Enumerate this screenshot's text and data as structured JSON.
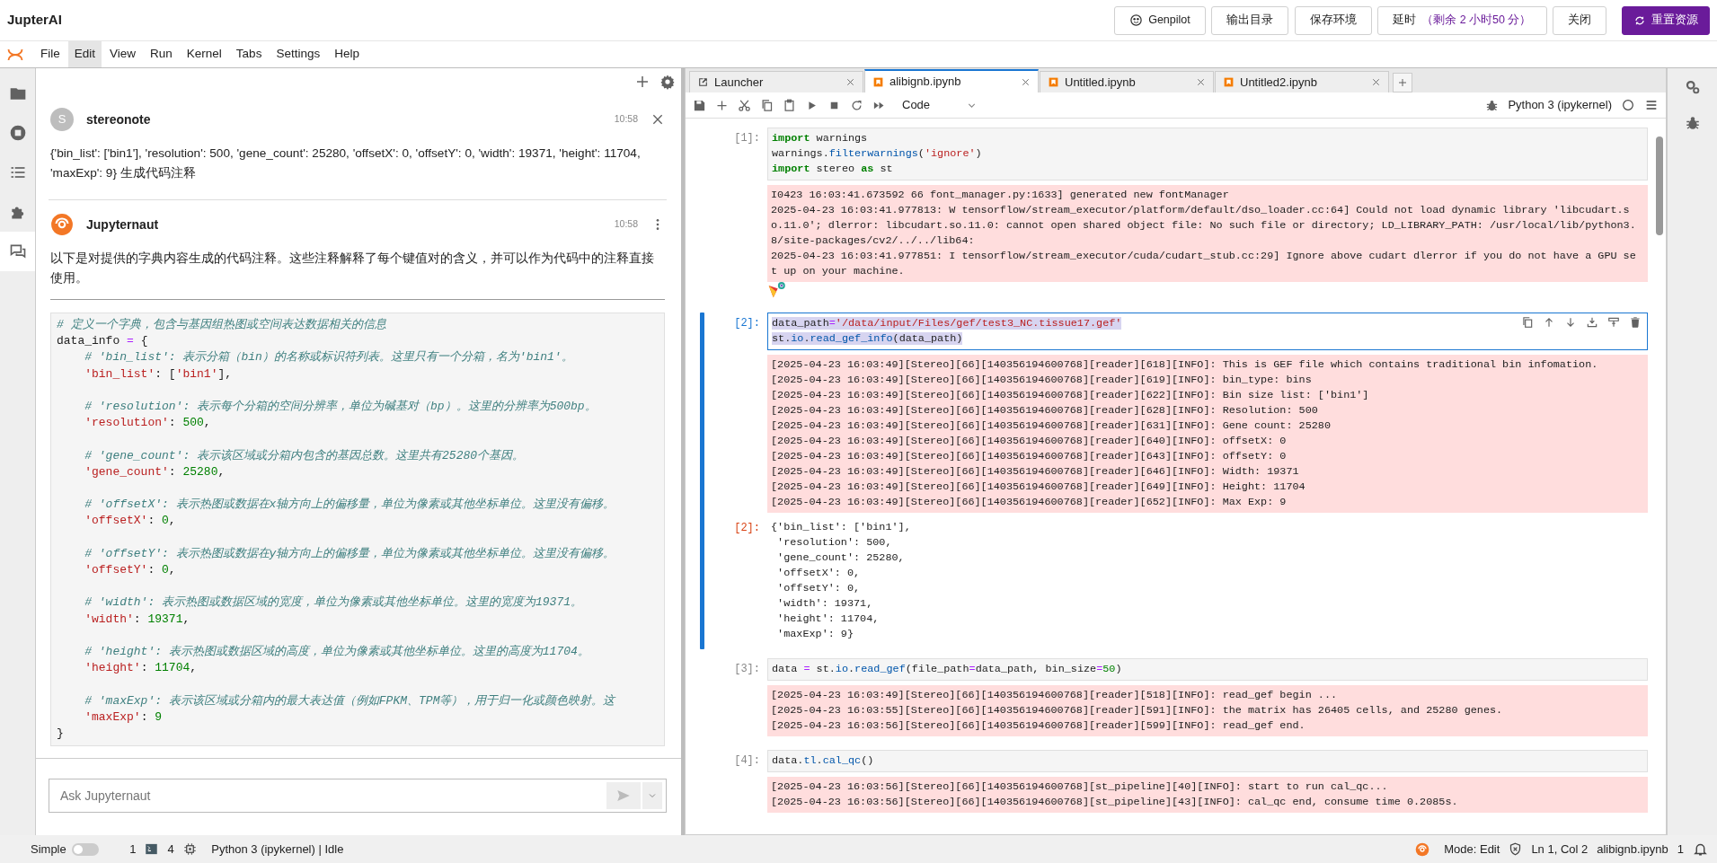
{
  "app": {
    "title": "JupterAI"
  },
  "top_buttons": [
    {
      "kind": "genpilot",
      "label": "Genpilot"
    },
    {
      "kind": "plain",
      "label": "输出目录"
    },
    {
      "kind": "plain",
      "label": "保存环境"
    },
    {
      "kind": "timer",
      "label": "延时",
      "detail": "（剩余 2 小时50 分）"
    },
    {
      "kind": "plain",
      "label": "关闭"
    },
    {
      "kind": "primary",
      "label": "重置资源"
    }
  ],
  "menu": [
    {
      "label": "File",
      "selected": false
    },
    {
      "label": "Edit",
      "selected": true
    },
    {
      "label": "View",
      "selected": false
    },
    {
      "label": "Run",
      "selected": false
    },
    {
      "label": "Kernel",
      "selected": false
    },
    {
      "label": "Tabs",
      "selected": false
    },
    {
      "label": "Settings",
      "selected": false
    },
    {
      "label": "Help",
      "selected": false
    }
  ],
  "left_sidebar": [
    {
      "kind": "folder",
      "selected": false
    },
    {
      "kind": "stop",
      "selected": false
    },
    {
      "kind": "list",
      "selected": false
    },
    {
      "kind": "puzzle",
      "selected": false
    },
    {
      "kind": "chat",
      "selected": true
    }
  ],
  "chat": {
    "messages": [
      {
        "kind": "user",
        "avatar": "S",
        "author": "stereonote",
        "time": "10:58",
        "text": "{'bin_list': ['bin1'], 'resolution': 500, 'gene_count': 25280, 'offsetX': 0, 'offsetY': 0, 'width': 19371, 'height': 11704, 'maxExp': 9} 生成代码注释"
      },
      {
        "kind": "bot",
        "author": "Jupyternaut",
        "time": "10:58",
        "text": "以下是对提供的字典内容生成的代码注释。这些注释解释了每个键值对的含义，并可以作为代码中的注释直接使用。",
        "code_blocks": [
          [
            [
              {
                "kind": "c",
                "text": "# 定义一个字典，包含与基因组热图或空间表达数据相关的信息"
              }
            ],
            [
              {
                "kind": "p",
                "text": "data_info "
              },
              {
                "kind": "o",
                "text": "="
              },
              {
                "kind": "p",
                "text": " {"
              }
            ],
            [
              {
                "kind": "c",
                "text": "    # 'bin_list': 表示分箱（bin）的名称或标识符列表。这里只有一个分箱，名为'bin1'。"
              }
            ],
            [
              {
                "kind": "s",
                "text": "    'bin_list'"
              },
              {
                "kind": "p",
                "text": ": ["
              },
              {
                "kind": "s",
                "text": "'bin1'"
              },
              {
                "kind": "p",
                "text": "],"
              }
            ]
          ],
          [
            [
              {
                "kind": "c",
                "text": "    # 'resolution': 表示每个分箱的空间分辨率，单位为碱基对（bp）。这里的分辨率为500bp。"
              }
            ],
            [
              {
                "kind": "s",
                "text": "    'resolution'"
              },
              {
                "kind": "p",
                "text": ": "
              },
              {
                "kind": "n",
                "text": "500"
              },
              {
                "kind": "p",
                "text": ","
              }
            ]
          ],
          [
            [
              {
                "kind": "c",
                "text": "    # 'gene_count': 表示该区域或分箱内包含的基因总数。这里共有25280个基因。"
              }
            ],
            [
              {
                "kind": "s",
                "text": "    'gene_count'"
              },
              {
                "kind": "p",
                "text": ": "
              },
              {
                "kind": "n",
                "text": "25280"
              },
              {
                "kind": "p",
                "text": ","
              }
            ]
          ],
          [
            [
              {
                "kind": "c",
                "text": "    # 'offsetX': 表示热图或数据在x轴方向上的偏移量，单位为像素或其他坐标单位。这里没有偏移。"
              }
            ],
            [
              {
                "kind": "s",
                "text": "    'offsetX'"
              },
              {
                "kind": "p",
                "text": ": "
              },
              {
                "kind": "n",
                "text": "0"
              },
              {
                "kind": "p",
                "text": ","
              }
            ]
          ],
          [
            [
              {
                "kind": "c",
                "text": "    # 'offsetY': 表示热图或数据在y轴方向上的偏移量，单位为像素或其他坐标单位。这里没有偏移。"
              }
            ],
            [
              {
                "kind": "s",
                "text": "    'offsetY'"
              },
              {
                "kind": "p",
                "text": ": "
              },
              {
                "kind": "n",
                "text": "0"
              },
              {
                "kind": "p",
                "text": ","
              }
            ]
          ],
          [
            [
              {
                "kind": "c",
                "text": "    # 'width': 表示热图或数据区域的宽度，单位为像素或其他坐标单位。这里的宽度为19371。"
              }
            ],
            [
              {
                "kind": "s",
                "text": "    'width'"
              },
              {
                "kind": "p",
                "text": ": "
              },
              {
                "kind": "n",
                "text": "19371"
              },
              {
                "kind": "p",
                "text": ","
              }
            ]
          ],
          [
            [
              {
                "kind": "c",
                "text": "    # 'height': 表示热图或数据区域的高度，单位为像素或其他坐标单位。这里的高度为11704。"
              }
            ],
            [
              {
                "kind": "s",
                "text": "    'height'"
              },
              {
                "kind": "p",
                "text": ": "
              },
              {
                "kind": "n",
                "text": "11704"
              },
              {
                "kind": "p",
                "text": ","
              }
            ]
          ],
          [
            [
              {
                "kind": "c",
                "text": "    # 'maxExp': 表示该区域或分箱内的最大表达值（例如FPKM、TPM等），用于归一化或颜色映射。这"
              }
            ],
            [
              {
                "kind": "s",
                "text": "    'maxExp'"
              },
              {
                "kind": "p",
                "text": ": "
              },
              {
                "kind": "n",
                "text": "9"
              }
            ],
            [
              {
                "kind": "p",
                "text": "}"
              }
            ]
          ]
        ]
      }
    ],
    "input": {
      "placeholder": "Ask Jupyternaut"
    }
  },
  "notebook": {
    "tabs": [
      {
        "kind": "launcher",
        "label": "Launcher",
        "selected": false
      },
      {
        "kind": "notebook",
        "label": "alibignb.ipynb",
        "selected": true
      },
      {
        "kind": "notebook",
        "label": "Untitled.ipynb",
        "selected": false
      },
      {
        "kind": "notebook",
        "label": "Untitled2.ipynb",
        "selected": false
      }
    ],
    "toolbar": {
      "cell_type": "Code",
      "kernel": "Python 3 (ipykernel)"
    },
    "cells": [
      {
        "prompt": "[1]:",
        "selected": false,
        "input": [
          [
            {
              "kind": "k",
              "text": "import"
            },
            {
              "kind": "p",
              "text": " warnings"
            }
          ],
          [
            {
              "kind": "p",
              "text": "warnings."
            },
            {
              "kind": "f",
              "text": "filterwarnings"
            },
            {
              "kind": "p",
              "text": "("
            },
            {
              "kind": "s",
              "text": "'ignore'"
            },
            {
              "kind": "p",
              "text": ")"
            }
          ],
          [
            {
              "kind": "k",
              "text": "import"
            },
            {
              "kind": "p",
              "text": " stereo "
            },
            {
              "kind": "k",
              "text": "as"
            },
            {
              "kind": "p",
              "text": " st"
            }
          ]
        ],
        "outputs": [
          {
            "kind": "stderr",
            "lines": [
              "I0423 16:03:41.673592 66 font_manager.py:1633] generated new fontManager",
              "2025-04-23 16:03:41.977813: W tensorflow/stream_executor/platform/default/dso_loader.cc:64] Could not load dynamic library 'libcudart.s",
              "o.11.0'; dlerror: libcudart.so.11.0: cannot open shared object file: No such file or directory; LD_LIBRARY_PATH: /usr/local/lib/python3.",
              "8/site-packages/cv2/../../lib64:",
              "2025-04-23 16:03:41.977851: I tensorflow/stream_executor/cuda/cudart_stub.cc:29] Ignore above cudart dlerror if you do not have a GPU se",
              "t up on your machine."
            ]
          },
          {
            "kind": "logo"
          }
        ]
      },
      {
        "prompt": "[2]:",
        "selected": true,
        "input": [
          [
            {
              "kind": "p",
              "text": "data_path"
            },
            {
              "kind": "o",
              "text": "="
            },
            {
              "kind": "s",
              "text": "'/data/input/Files/gef/test3_NC.tissue17.gef'"
            }
          ],
          [
            {
              "kind": "p",
              "text": "st."
            },
            {
              "kind": "f",
              "text": "io"
            },
            {
              "kind": "p",
              "text": "."
            },
            {
              "kind": "f",
              "text": "read_gef_info"
            },
            {
              "kind": "p",
              "text": "(data_path)"
            }
          ]
        ],
        "outputs": [
          {
            "kind": "stderr",
            "lines": [
              "[2025-04-23 16:03:49][Stereo][66][140356194600768][reader][618][INFO]: This is GEF file which contains traditional bin infomation.",
              "[2025-04-23 16:03:49][Stereo][66][140356194600768][reader][619][INFO]: bin_type: bins",
              "[2025-04-23 16:03:49][Stereo][66][140356194600768][reader][622][INFO]: Bin size list: ['bin1']",
              "[2025-04-23 16:03:49][Stereo][66][140356194600768][reader][628][INFO]: Resolution: 500",
              "[2025-04-23 16:03:49][Stereo][66][140356194600768][reader][631][INFO]: Gene count: 25280",
              "[2025-04-23 16:03:49][Stereo][66][140356194600768][reader][640][INFO]: offsetX: 0",
              "[2025-04-23 16:03:49][Stereo][66][140356194600768][reader][643][INFO]: offsetY: 0",
              "[2025-04-23 16:03:49][Stereo][66][140356194600768][reader][646][INFO]: Width: 19371",
              "[2025-04-23 16:03:49][Stereo][66][140356194600768][reader][649][INFO]: Height: 11704",
              "[2025-04-23 16:03:49][Stereo][66][140356194600768][reader][652][INFO]: Max Exp: 9"
            ]
          },
          {
            "kind": "result",
            "prompt": "[2]:",
            "lines": [
              "{'bin_list': ['bin1'],",
              " 'resolution': 500,",
              " 'gene_count': 25280,",
              " 'offsetX': 0,",
              " 'offsetY': 0,",
              " 'width': 19371,",
              " 'height': 11704,",
              " 'maxExp': 9}"
            ]
          }
        ]
      },
      {
        "prompt": "[3]:",
        "selected": false,
        "input": [
          [
            {
              "kind": "p",
              "text": "data "
            },
            {
              "kind": "o",
              "text": "="
            },
            {
              "kind": "p",
              "text": " st."
            },
            {
              "kind": "f",
              "text": "io"
            },
            {
              "kind": "p",
              "text": "."
            },
            {
              "kind": "f",
              "text": "read_gef"
            },
            {
              "kind": "p",
              "text": "(file_path"
            },
            {
              "kind": "o",
              "text": "="
            },
            {
              "kind": "p",
              "text": "data_path, bin_size"
            },
            {
              "kind": "o",
              "text": "="
            },
            {
              "kind": "n",
              "text": "50"
            },
            {
              "kind": "p",
              "text": ")"
            }
          ]
        ],
        "outputs": [
          {
            "kind": "stderr",
            "lines": [
              "[2025-04-23 16:03:49][Stereo][66][140356194600768][reader][518][INFO]: read_gef begin ...",
              "[2025-04-23 16:03:55][Stereo][66][140356194600768][reader][591][INFO]: the matrix has 26405 cells, and 25280 genes.",
              "[2025-04-23 16:03:56][Stereo][66][140356194600768][reader][599][INFO]: read_gef end."
            ]
          }
        ]
      },
      {
        "prompt": "[4]:",
        "selected": false,
        "input": [
          [
            {
              "kind": "p",
              "text": "data."
            },
            {
              "kind": "f",
              "text": "tl"
            },
            {
              "kind": "p",
              "text": "."
            },
            {
              "kind": "f",
              "text": "cal_qc"
            },
            {
              "kind": "p",
              "text": "()"
            }
          ]
        ],
        "outputs": [
          {
            "kind": "stderr",
            "lines": [
              "[2025-04-23 16:03:56][Stereo][66][140356194600768][st_pipeline][40][INFO]: start to run cal_qc...",
              "[2025-04-23 16:03:56][Stereo][66][140356194600768][st_pipeline][43][INFO]: cal_qc end, consume time 0.2085s."
            ]
          }
        ]
      }
    ]
  },
  "status_bar": {
    "mode_label": "Simple",
    "simple_on": false,
    "terminals": "1",
    "kernels": "4",
    "kernel_status": "Python 3 (ipykernel) | Idle",
    "mode": "Mode: Edit",
    "position": "Ln 1, Col 2",
    "file": "alibignb.ipynb",
    "notifications": "1"
  }
}
